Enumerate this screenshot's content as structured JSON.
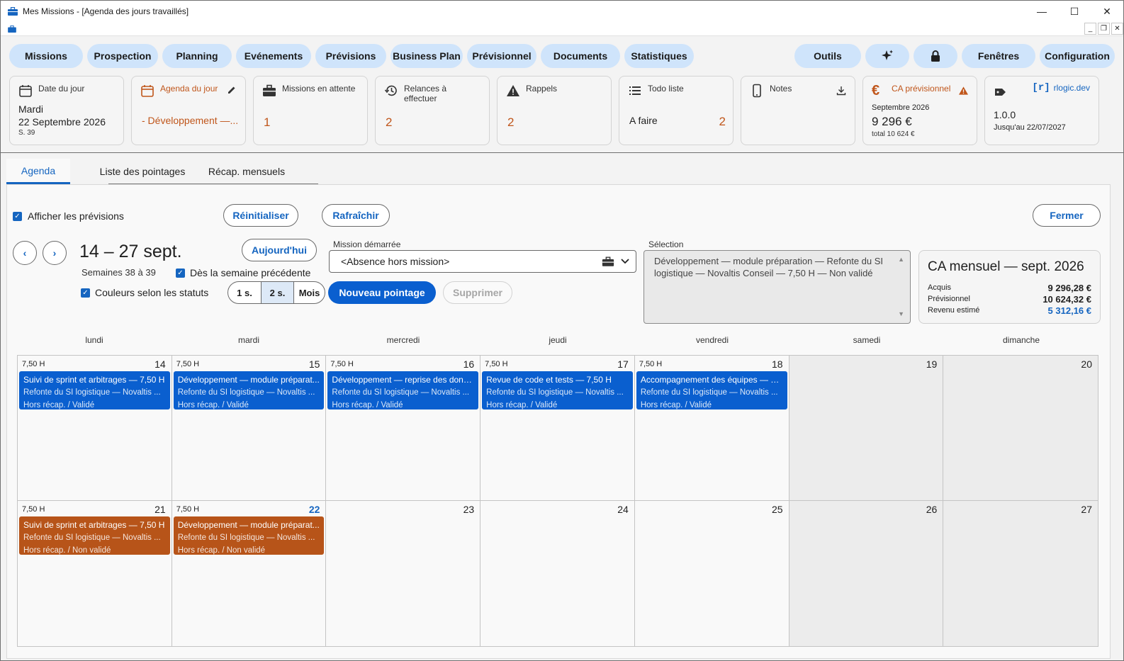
{
  "window": {
    "title": "Mes Missions - [Agenda des jours travaillés]"
  },
  "nav": {
    "left": [
      "Missions",
      "Prospection",
      "Planning",
      "Evénements",
      "Prévisions",
      "Business Plan",
      "Prévisionnel",
      "Documents",
      "Statistiques"
    ],
    "right_outils": "Outils",
    "right_fenetres": "Fenêtres",
    "right_configuration": "Configuration"
  },
  "cards": {
    "date": {
      "label": "Date du jour",
      "day": "Mardi",
      "date": "22 Septembre 2026",
      "week": "S. 39"
    },
    "agenda": {
      "label": "Agenda du jour",
      "value": "- Développement —..."
    },
    "missions": {
      "label": "Missions en attente",
      "value": "1"
    },
    "relances": {
      "label": "Relances à effectuer",
      "value": "2"
    },
    "rappels": {
      "label": "Rappels",
      "value": "2"
    },
    "todo": {
      "label": "Todo liste",
      "item": "A faire",
      "value": "2"
    },
    "notes": {
      "label": "Notes"
    },
    "ca": {
      "label": "CA prévisionnel",
      "month": "Septembre 2026",
      "amount": "9 296 €",
      "total": "total 10 624 €"
    },
    "license": {
      "brand": "rlogic.dev",
      "version": "1.0.0",
      "until": "Jusqu'au 22/07/2027"
    }
  },
  "tabs": [
    "Agenda",
    "Liste des pointages",
    "Récap. mensuels"
  ],
  "toolbar": {
    "show_forecast": "Afficher les prévisions",
    "reset": "Réinitialiser",
    "refresh": "Rafraîchir",
    "close": "Fermer",
    "today": "Aujourd'hui",
    "range": "14 – 27 sept.",
    "weeks": "Semaines 38 à 39",
    "from_prev_week": "Dès la semaine précédente",
    "status_colors": "Couleurs selon les statuts",
    "view_1w": "1 s.",
    "view_2w": "2 s.",
    "view_month": "Mois",
    "new_entry": "Nouveau pointage",
    "delete": "Supprimer",
    "mission_label": "Mission démarrée",
    "mission_value": "<Absence hors mission>",
    "selection_label": "Sélection",
    "selection_text": "Développement — module préparation — Refonte du SI logistique — Novaltis Conseil — 7,50 H — Non validé"
  },
  "ca_mensuel": {
    "title": "CA mensuel — sept. 2026",
    "acquis_label": "Acquis",
    "acquis": "9 296,28 €",
    "prev_label": "Prévisionnel",
    "prev": "10 624,32 €",
    "rev_label": "Revenu estimé",
    "rev": "5 312,16 €"
  },
  "calendar": {
    "days_of_week": [
      "lundi",
      "mardi",
      "mercredi",
      "jeudi",
      "vendredi",
      "samedi",
      "dimanche"
    ],
    "cells": [
      {
        "day": "14",
        "hours": "7,50 H",
        "event": {
          "title": "Suivi de sprint et arbitrages — 7,50 H",
          "project": "Refonte du SI logistique — Novaltis ...",
          "status": "Hors récap. / Validé",
          "color": "blue"
        }
      },
      {
        "day": "15",
        "hours": "7,50 H",
        "event": {
          "title": "Développement — module préparat...",
          "project": "Refonte du SI logistique — Novaltis ...",
          "status": "Hors récap. / Validé",
          "color": "blue"
        }
      },
      {
        "day": "16",
        "hours": "7,50 H",
        "event": {
          "title": "Développement — reprise des donn...",
          "project": "Refonte du SI logistique — Novaltis ...",
          "status": "Hors récap. / Validé",
          "color": "blue"
        }
      },
      {
        "day": "17",
        "hours": "7,50 H",
        "event": {
          "title": "Revue de code et tests — 7,50 H",
          "project": "Refonte du SI logistique — Novaltis ...",
          "status": "Hors récap. / Validé",
          "color": "blue"
        }
      },
      {
        "day": "18",
        "hours": "7,50 H",
        "event": {
          "title": "Accompagnement des équipes — 7,...",
          "project": "Refonte du SI logistique — Novaltis ...",
          "status": "Hors récap. / Validé",
          "color": "blue"
        }
      },
      {
        "day": "19",
        "weekend": true
      },
      {
        "day": "20",
        "weekend": true
      },
      {
        "day": "21",
        "hours": "7,50 H",
        "event": {
          "title": "Suivi de sprint et arbitrages — 7,50 H",
          "project": "Refonte du SI logistique — Novaltis ...",
          "status": "Hors récap. / Non validé",
          "color": "orange"
        }
      },
      {
        "day": "22",
        "hours": "7,50 H",
        "today": true,
        "event": {
          "title": "Développement — module préparat...",
          "project": "Refonte du SI logistique — Novaltis ...",
          "status": "Hors récap. / Non validé",
          "color": "orange"
        }
      },
      {
        "day": "23"
      },
      {
        "day": "24"
      },
      {
        "day": "25"
      },
      {
        "day": "26",
        "weekend": true
      },
      {
        "day": "27",
        "weekend": true
      }
    ]
  },
  "colors": {
    "accent": "#1565c0",
    "event_validated": "#0a5fcf",
    "event_pending": "#b75419",
    "warning": "#c0561b"
  }
}
